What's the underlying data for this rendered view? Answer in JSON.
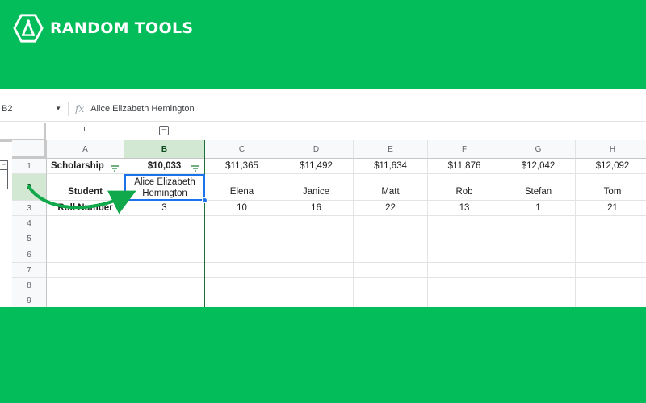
{
  "brand": {
    "name": "RANDOM TOOLS",
    "logo_icon": "compass-hexagon-icon",
    "background": "#03bd5b"
  },
  "formula_bar": {
    "cell_ref": "B2",
    "fx_label": "fx",
    "value": "Alice Elizabeth Hemington"
  },
  "group_collapse_label": "−",
  "row_group_label": "−",
  "columns": [
    "A",
    "B",
    "C",
    "D",
    "E",
    "F",
    "G",
    "H"
  ],
  "selected_column": "B",
  "rows": [
    {
      "num": "1",
      "cells": [
        "Scholarship",
        "$10,033",
        "$11,365",
        "$11,492",
        "$11,634",
        "$11,876",
        "$12,042",
        "$12,092"
      ]
    },
    {
      "num": "2",
      "cells": [
        "Student",
        "Alice Elizabeth Hemington",
        "Elena",
        "Janice",
        "Matt",
        "Rob",
        "Stefan",
        "Tom"
      ]
    },
    {
      "num": "3",
      "cells": [
        "Roll Number",
        "3",
        "10",
        "16",
        "22",
        "13",
        "1",
        "21"
      ]
    },
    {
      "num": "4",
      "cells": [
        "",
        "",
        "",
        "",
        "",
        "",
        "",
        ""
      ]
    },
    {
      "num": "5",
      "cells": [
        "",
        "",
        "",
        "",
        "",
        "",
        "",
        ""
      ]
    },
    {
      "num": "6",
      "cells": [
        "",
        "",
        "",
        "",
        "",
        "",
        "",
        ""
      ]
    },
    {
      "num": "7",
      "cells": [
        "",
        "",
        "",
        "",
        "",
        "",
        "",
        ""
      ]
    },
    {
      "num": "8",
      "cells": [
        "",
        "",
        "",
        "",
        "",
        "",
        "",
        ""
      ]
    },
    {
      "num": "9",
      "cells": [
        "",
        "",
        "",
        "",
        "",
        "",
        "",
        ""
      ]
    }
  ],
  "active_cell": "B2",
  "annotation": {
    "type": "arrow",
    "color": "#0fa84a",
    "points_to": "B2"
  }
}
